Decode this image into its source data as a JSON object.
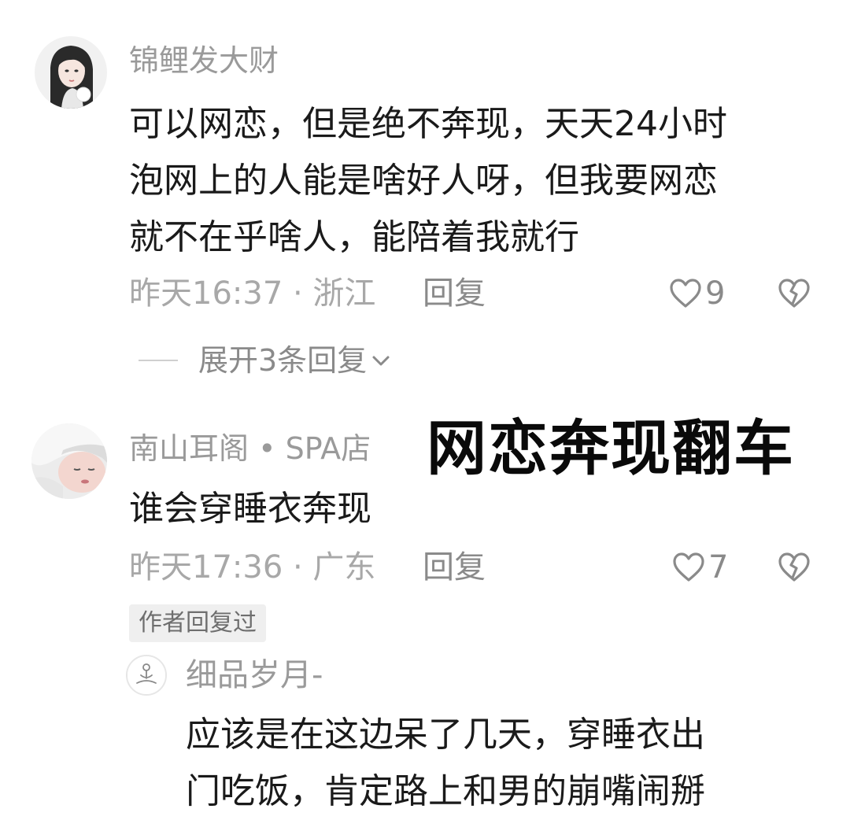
{
  "comments": [
    {
      "username": "锦鲤发大财",
      "lines": [
        "可以网恋，但是绝不奔现，天天24小时",
        "泡网上的人能是啥好人呀，但我要网恋",
        "就不在乎啥人，能陪着我就行"
      ],
      "meta": "昨天16:37 · 浙江",
      "reply_label": "回复",
      "likes": "9",
      "expand_label": "展开3条回复"
    },
    {
      "username": "南山耳阁 • SPA店",
      "lines": [
        "谁会穿睡衣奔现"
      ],
      "meta": "昨天17:36 · 广东",
      "reply_label": "回复",
      "likes": "7",
      "author_badge": "作者回复过"
    }
  ],
  "overlay_title": "网恋奔现翻车",
  "sub_reply": {
    "username": "细品岁月-",
    "lines": [
      "应该是在这边呆了几天，穿睡衣出",
      "门吃饭，肯定路上和男的崩嘴闹掰"
    ]
  },
  "colors": {
    "text_primary": "#1a1a1a",
    "text_secondary": "#9a9a9a",
    "badge_bg": "#efefef"
  },
  "icons": [
    "heart-outline-icon",
    "broken-heart-icon",
    "chevron-down-icon",
    "meditation-avatar-icon"
  ]
}
